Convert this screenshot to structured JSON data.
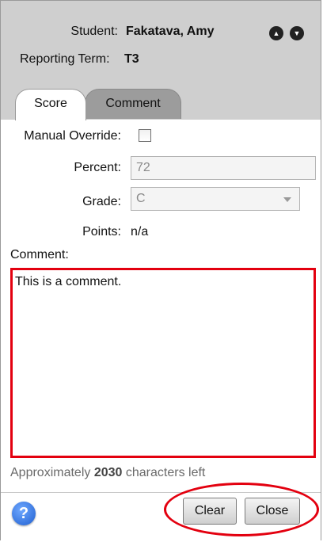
{
  "header": {
    "student_label": "Student:",
    "student_value": "Fakatava, Amy",
    "reporting_term_label": "Reporting Term:",
    "reporting_term_value": "T3"
  },
  "tabs": [
    {
      "label": "Score",
      "active": true
    },
    {
      "label": "Comment",
      "active": false
    }
  ],
  "form": {
    "manual_override_label": "Manual Override:",
    "manual_override_checked": false,
    "percent_label": "Percent:",
    "percent_value": "72",
    "grade_label": "Grade:",
    "grade_value": "C",
    "points_label": "Points:",
    "points_value": "n/a"
  },
  "comment": {
    "label": "Comment:",
    "text": "This is a comment.",
    "chars_left_prefix": "Approximately",
    "chars_left_count": "2030",
    "chars_left_suffix": "characters left"
  },
  "footer": {
    "help_icon": "?",
    "clear_label": "Clear",
    "close_label": "Close"
  },
  "colors": {
    "header_bg": "#cfcfcf",
    "highlight": "#e3000f"
  },
  "icons": {
    "previous": "previous-student-icon",
    "next": "next-student-icon",
    "help": "help-icon"
  }
}
